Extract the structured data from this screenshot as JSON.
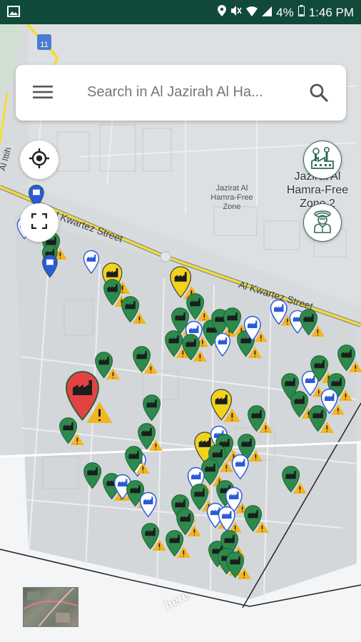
{
  "status_bar": {
    "battery": "4%",
    "time": "1:46 PM"
  },
  "search": {
    "placeholder": "Search in Al Jazirah Al Ha..."
  },
  "map": {
    "labels": {
      "zone_small": "Jazirat Al Hamra-Free Zone",
      "zone_large": "Jazirat Al Hamra-Free Zone 2",
      "street_1": "Al Kwartez Street",
      "street_2": "Al Kwartez Street",
      "road_shield": "11",
      "road_vertical": "Al Ittih",
      "watermark": "here"
    },
    "marker_colors": {
      "green": "#2e8a4c",
      "yellow": "#f1d31c",
      "white": "#ffffff",
      "red": "#e24342",
      "warning": "#f3b523"
    }
  },
  "controls": {
    "locate_icon": "crosshair-icon",
    "fullscreen_icon": "fullscreen-icon",
    "factory_icon": "factory-icon",
    "inspector_icon": "inspector-icon"
  }
}
